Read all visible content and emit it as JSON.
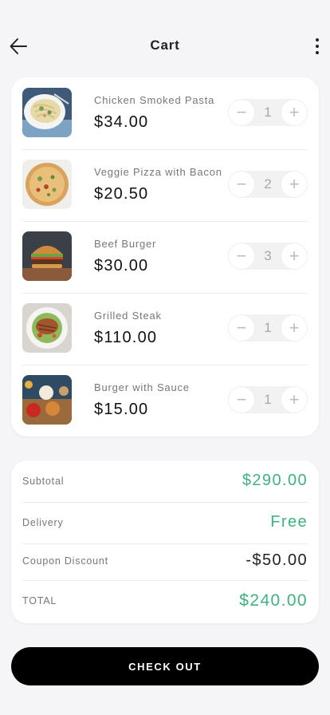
{
  "header": {
    "title": "Cart",
    "back_icon": "arrow-left-icon",
    "more_icon": "more-vertical-icon"
  },
  "cart": {
    "items": [
      {
        "name": "Chicken Smoked Pasta",
        "price": "$34.00",
        "quantity": "1"
      },
      {
        "name": "Veggie Pizza with Bacon",
        "price": "$20.50",
        "quantity": "2"
      },
      {
        "name": "Beef Burger",
        "price": "$30.00",
        "quantity": "3"
      },
      {
        "name": "Grilled Steak",
        "price": "$110.00",
        "quantity": "1"
      },
      {
        "name": "Burger with Sauce",
        "price": "$15.00",
        "quantity": "1"
      }
    ],
    "stepper": {
      "minus": "−",
      "plus": "+"
    }
  },
  "summary": {
    "subtotal_label": "Subtotal",
    "subtotal_value": "$290.00",
    "delivery_label": "Delivery",
    "delivery_value": "Free",
    "coupon_label": "Coupon Discount",
    "coupon_value": "-$50.00",
    "total_label": "TOTAL",
    "total_value": "$240.00"
  },
  "checkout_label": "CHECK OUT",
  "colors": {
    "accent_green": "#3db37f",
    "button_black": "#000000",
    "background": "#f5f5f7"
  }
}
